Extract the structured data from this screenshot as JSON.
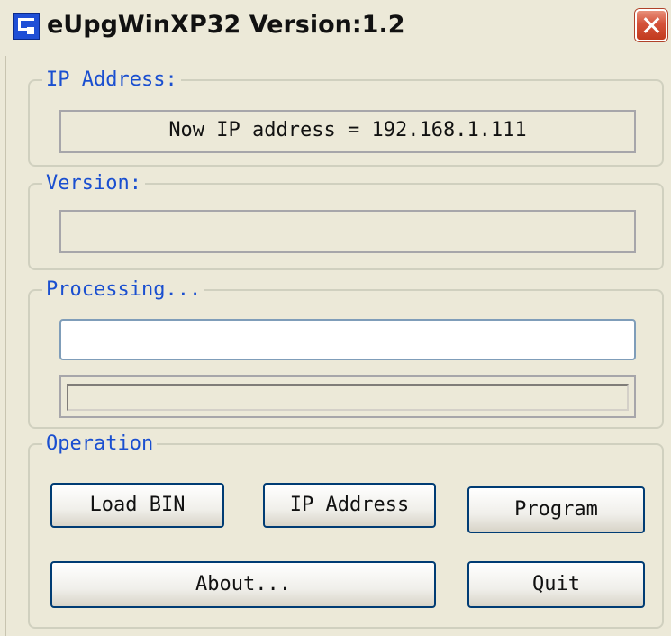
{
  "window": {
    "title": "eUpgWinXP32 Version:1.2"
  },
  "ip_group": {
    "legend": "IP Address:",
    "readout": "Now IP address = 192.168.1.111"
  },
  "version_group": {
    "legend": "Version:",
    "readout": ""
  },
  "processing_group": {
    "legend": "Processing...",
    "input_value": "",
    "progress_fraction": 0
  },
  "operation_group": {
    "legend": "Operation",
    "buttons": {
      "load_bin": "Load BIN",
      "ip_address": "IP Address",
      "program": "Program",
      "about": "About...",
      "quit": "Quit"
    }
  },
  "icons": {
    "app": "app-icon",
    "close": "close-icon"
  },
  "colors": {
    "legend_text": "#1A4FD0",
    "window_bg": "#ECE9D8",
    "close_button": "#D4523A"
  }
}
